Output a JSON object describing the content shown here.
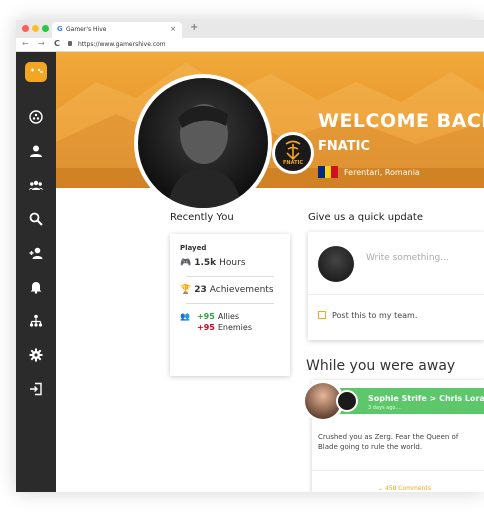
{
  "browser": {
    "tab_title": "Gamer's Hive",
    "tab_close": "×",
    "new_tab": "+",
    "url": "https://www.gamershive.com",
    "nav_back": "←",
    "nav_forward": "→",
    "nav_reload": "C"
  },
  "colors": {
    "accent": "#f4a521",
    "sidebar_bg": "#2b2b2b",
    "hero_bg": "#e9952a",
    "positive": "#2ea43c",
    "negative": "#d0021b",
    "feed_header": "#5cc76b"
  },
  "sidebar": {
    "items": [
      {
        "icon": "gamepad-logo-icon"
      },
      {
        "icon": "dashboard-icon"
      },
      {
        "icon": "user-icon"
      },
      {
        "icon": "group-icon"
      },
      {
        "icon": "search-icon"
      },
      {
        "icon": "add-user-icon"
      },
      {
        "icon": "bell-icon"
      },
      {
        "icon": "hierarchy-icon"
      },
      {
        "icon": "gear-icon"
      },
      {
        "icon": "logout-icon"
      }
    ]
  },
  "hero": {
    "welcome": "WELCOME BACK, A",
    "team": "FNATIC",
    "location": "Ferentari, Romania",
    "badge": "FNATIC"
  },
  "recently": {
    "title": "Recently You",
    "played_label": "Played",
    "hours_value": "1.5k",
    "hours_label": "Hours",
    "achievements_value": "23",
    "achievements_label": "Achievements",
    "allies_value": "+95",
    "allies_label": "Allies",
    "enemies_value": "+95",
    "enemies_label": "Enemies"
  },
  "update": {
    "title": "Give us a quick update",
    "placeholder": "Write something...",
    "checkbox_label": "Post this to my team."
  },
  "away": {
    "title": "While you were away",
    "from": "Sophie Strife",
    "separator": ">",
    "to": "Chris Lorang",
    "time": "3 days ago....",
    "message": "Crushed you as Zerg. Fear the Queen of Blade going to rule the world.",
    "comments": "458 Comments"
  }
}
